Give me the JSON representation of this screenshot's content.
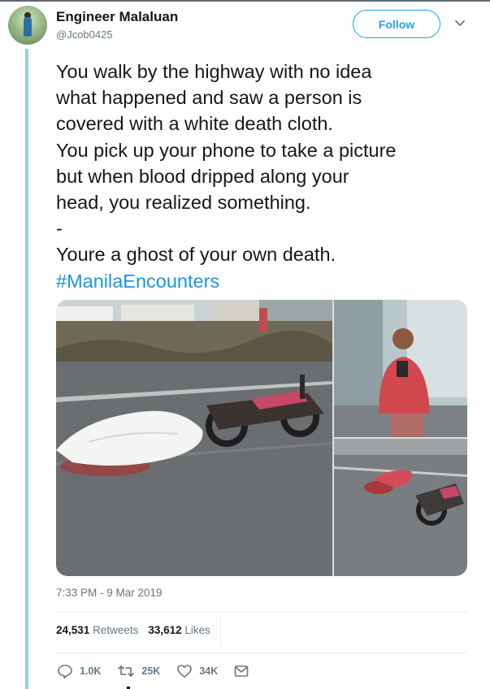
{
  "user": {
    "display_name": "Engineer Malaluan",
    "handle": "@Jcob0425",
    "follow_label": "Follow"
  },
  "tweet": {
    "lines": [
      "You walk by the highway with no idea",
      "what happened and saw a person is",
      "covered with a white death cloth.",
      "You pick up your phone to take a picture",
      "but when blood dripped along your",
      "head, you realized something.",
      "-",
      "Youre a ghost of your own death."
    ],
    "hashtag": "#ManilaEncounters"
  },
  "meta": {
    "timestamp": "7:33 PM - 9 Mar 2019"
  },
  "stats": {
    "retweets_count": "24,531",
    "retweets_label": "Retweets",
    "likes_count": "33,612",
    "likes_label": "Likes"
  },
  "actions": {
    "replies": "1.0K",
    "retweets": "25K",
    "likes": "34K"
  },
  "icons": [
    "chevron-down-icon",
    "reply-icon",
    "retweet-icon",
    "heart-icon",
    "message-icon"
  ],
  "colors": {
    "accent": "#1da1f2",
    "hashtag": "#1b95e0",
    "muted": "#657786",
    "thread_line": "#9ecbe8"
  }
}
